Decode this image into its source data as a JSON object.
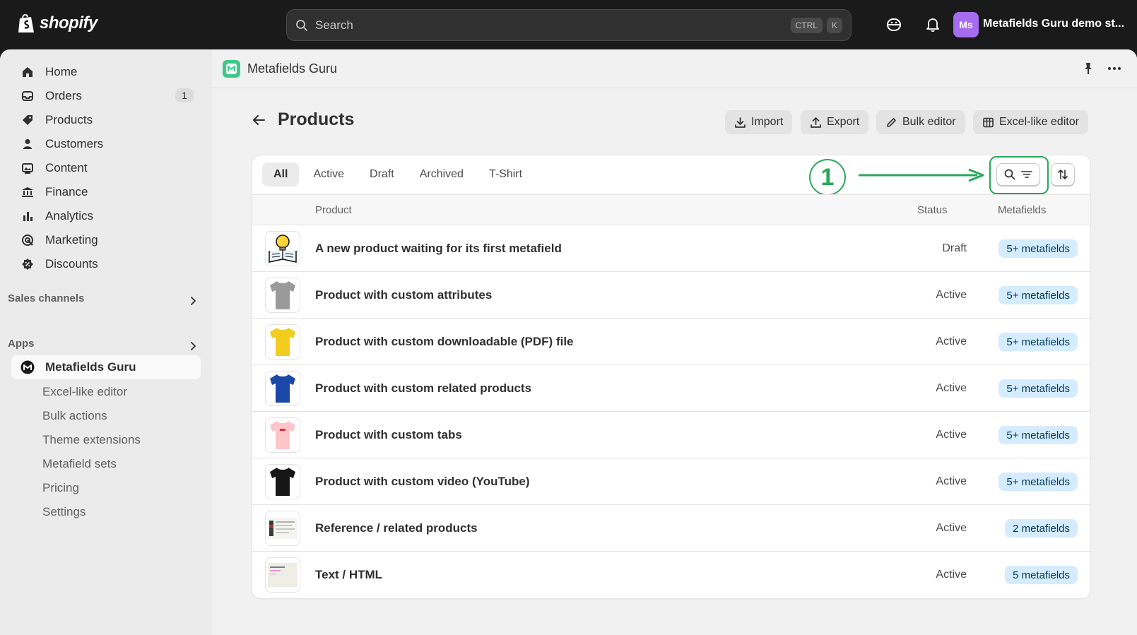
{
  "topbar": {
    "logo_text": "shopify",
    "search_placeholder": "Search",
    "shortcut_keys": [
      "CTRL",
      "K"
    ],
    "avatar_initials": "Ms",
    "store_name": "Metafields Guru demo st..."
  },
  "sidebar": {
    "items": [
      {
        "label": "Home",
        "icon": "home-icon"
      },
      {
        "label": "Orders",
        "icon": "orders-icon",
        "badge": "1"
      },
      {
        "label": "Products",
        "icon": "tag-icon"
      },
      {
        "label": "Customers",
        "icon": "person-icon"
      },
      {
        "label": "Content",
        "icon": "content-icon"
      },
      {
        "label": "Finance",
        "icon": "bank-icon"
      },
      {
        "label": "Analytics",
        "icon": "bar-chart-icon"
      },
      {
        "label": "Marketing",
        "icon": "target-icon"
      },
      {
        "label": "Discounts",
        "icon": "discount-icon"
      }
    ],
    "sales_channels_label": "Sales channels",
    "apps_label": "Apps",
    "active_app": "Metafields Guru",
    "app_subitems": [
      "Excel-like editor",
      "Bulk actions",
      "Theme extensions",
      "Metafield sets",
      "Pricing",
      "Settings"
    ]
  },
  "app_header": {
    "title": "Metafields Guru"
  },
  "page": {
    "title": "Products",
    "actions": {
      "import": "Import",
      "export": "Export",
      "bulk_editor": "Bulk editor",
      "excel_editor": "Excel-like editor"
    }
  },
  "tabs": [
    "All",
    "Active",
    "Draft",
    "Archived",
    "T-Shirt"
  ],
  "annotation": {
    "number": "1",
    "color": "#26a85a"
  },
  "table": {
    "headers": {
      "product": "Product",
      "status": "Status",
      "metafields": "Metafields"
    },
    "rows": [
      {
        "name": "A new product waiting for its first metafield",
        "status": "Draft",
        "metafields": "5+ metafields",
        "thumb": "lightbulb-book-icon"
      },
      {
        "name": "Product with custom attributes",
        "status": "Active",
        "metafields": "5+ metafields",
        "thumb": "gray-tshirt",
        "color": "#9a9a9a"
      },
      {
        "name": "Product with custom downloadable (PDF) file",
        "status": "Active",
        "metafields": "5+ metafields",
        "thumb": "yellow-tshirt",
        "color": "#f2cc1f"
      },
      {
        "name": "Product with custom related products",
        "status": "Active",
        "metafields": "5+ metafields",
        "thumb": "blue-tshirt",
        "color": "#1b48a8"
      },
      {
        "name": "Product with custom tabs",
        "status": "Active",
        "metafields": "5+ metafields",
        "thumb": "pink-tshirt",
        "color": "#ffc5c9"
      },
      {
        "name": "Product with custom video (YouTube)",
        "status": "Active",
        "metafields": "5+ metafields",
        "thumb": "black-tshirt",
        "color": "#161616"
      },
      {
        "name": "Reference / related products",
        "status": "Active",
        "metafields": "2 metafields",
        "thumb": "page-screenshot-thumb"
      },
      {
        "name": "Text / HTML",
        "status": "Active",
        "metafields": "5 metafields",
        "thumb": "text-card-thumb"
      }
    ]
  },
  "colors": {
    "topbar": "#1a1a1a",
    "badge_bg": "#d5ebff",
    "badge_text": "#003a5a",
    "app_accent": "#3dc88a"
  }
}
